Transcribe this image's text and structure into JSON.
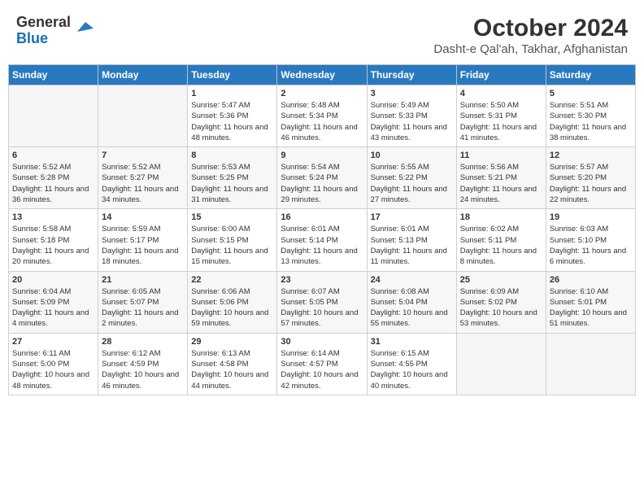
{
  "header": {
    "logo_general": "General",
    "logo_blue": "Blue",
    "month": "October 2024",
    "location": "Dasht-e Qal'ah, Takhar, Afghanistan"
  },
  "weekdays": [
    "Sunday",
    "Monday",
    "Tuesday",
    "Wednesday",
    "Thursday",
    "Friday",
    "Saturday"
  ],
  "weeks": [
    [
      {
        "day": "",
        "sunrise": "",
        "sunset": "",
        "daylight": ""
      },
      {
        "day": "",
        "sunrise": "",
        "sunset": "",
        "daylight": ""
      },
      {
        "day": "1",
        "sunrise": "Sunrise: 5:47 AM",
        "sunset": "Sunset: 5:36 PM",
        "daylight": "Daylight: 11 hours and 48 minutes."
      },
      {
        "day": "2",
        "sunrise": "Sunrise: 5:48 AM",
        "sunset": "Sunset: 5:34 PM",
        "daylight": "Daylight: 11 hours and 46 minutes."
      },
      {
        "day": "3",
        "sunrise": "Sunrise: 5:49 AM",
        "sunset": "Sunset: 5:33 PM",
        "daylight": "Daylight: 11 hours and 43 minutes."
      },
      {
        "day": "4",
        "sunrise": "Sunrise: 5:50 AM",
        "sunset": "Sunset: 5:31 PM",
        "daylight": "Daylight: 11 hours and 41 minutes."
      },
      {
        "day": "5",
        "sunrise": "Sunrise: 5:51 AM",
        "sunset": "Sunset: 5:30 PM",
        "daylight": "Daylight: 11 hours and 38 minutes."
      }
    ],
    [
      {
        "day": "6",
        "sunrise": "Sunrise: 5:52 AM",
        "sunset": "Sunset: 5:28 PM",
        "daylight": "Daylight: 11 hours and 36 minutes."
      },
      {
        "day": "7",
        "sunrise": "Sunrise: 5:52 AM",
        "sunset": "Sunset: 5:27 PM",
        "daylight": "Daylight: 11 hours and 34 minutes."
      },
      {
        "day": "8",
        "sunrise": "Sunrise: 5:53 AM",
        "sunset": "Sunset: 5:25 PM",
        "daylight": "Daylight: 11 hours and 31 minutes."
      },
      {
        "day": "9",
        "sunrise": "Sunrise: 5:54 AM",
        "sunset": "Sunset: 5:24 PM",
        "daylight": "Daylight: 11 hours and 29 minutes."
      },
      {
        "day": "10",
        "sunrise": "Sunrise: 5:55 AM",
        "sunset": "Sunset: 5:22 PM",
        "daylight": "Daylight: 11 hours and 27 minutes."
      },
      {
        "day": "11",
        "sunrise": "Sunrise: 5:56 AM",
        "sunset": "Sunset: 5:21 PM",
        "daylight": "Daylight: 11 hours and 24 minutes."
      },
      {
        "day": "12",
        "sunrise": "Sunrise: 5:57 AM",
        "sunset": "Sunset: 5:20 PM",
        "daylight": "Daylight: 11 hours and 22 minutes."
      }
    ],
    [
      {
        "day": "13",
        "sunrise": "Sunrise: 5:58 AM",
        "sunset": "Sunset: 5:18 PM",
        "daylight": "Daylight: 11 hours and 20 minutes."
      },
      {
        "day": "14",
        "sunrise": "Sunrise: 5:59 AM",
        "sunset": "Sunset: 5:17 PM",
        "daylight": "Daylight: 11 hours and 18 minutes."
      },
      {
        "day": "15",
        "sunrise": "Sunrise: 6:00 AM",
        "sunset": "Sunset: 5:15 PM",
        "daylight": "Daylight: 11 hours and 15 minutes."
      },
      {
        "day": "16",
        "sunrise": "Sunrise: 6:01 AM",
        "sunset": "Sunset: 5:14 PM",
        "daylight": "Daylight: 11 hours and 13 minutes."
      },
      {
        "day": "17",
        "sunrise": "Sunrise: 6:01 AM",
        "sunset": "Sunset: 5:13 PM",
        "daylight": "Daylight: 11 hours and 11 minutes."
      },
      {
        "day": "18",
        "sunrise": "Sunrise: 6:02 AM",
        "sunset": "Sunset: 5:11 PM",
        "daylight": "Daylight: 11 hours and 8 minutes."
      },
      {
        "day": "19",
        "sunrise": "Sunrise: 6:03 AM",
        "sunset": "Sunset: 5:10 PM",
        "daylight": "Daylight: 11 hours and 6 minutes."
      }
    ],
    [
      {
        "day": "20",
        "sunrise": "Sunrise: 6:04 AM",
        "sunset": "Sunset: 5:09 PM",
        "daylight": "Daylight: 11 hours and 4 minutes."
      },
      {
        "day": "21",
        "sunrise": "Sunrise: 6:05 AM",
        "sunset": "Sunset: 5:07 PM",
        "daylight": "Daylight: 11 hours and 2 minutes."
      },
      {
        "day": "22",
        "sunrise": "Sunrise: 6:06 AM",
        "sunset": "Sunset: 5:06 PM",
        "daylight": "Daylight: 10 hours and 59 minutes."
      },
      {
        "day": "23",
        "sunrise": "Sunrise: 6:07 AM",
        "sunset": "Sunset: 5:05 PM",
        "daylight": "Daylight: 10 hours and 57 minutes."
      },
      {
        "day": "24",
        "sunrise": "Sunrise: 6:08 AM",
        "sunset": "Sunset: 5:04 PM",
        "daylight": "Daylight: 10 hours and 55 minutes."
      },
      {
        "day": "25",
        "sunrise": "Sunrise: 6:09 AM",
        "sunset": "Sunset: 5:02 PM",
        "daylight": "Daylight: 10 hours and 53 minutes."
      },
      {
        "day": "26",
        "sunrise": "Sunrise: 6:10 AM",
        "sunset": "Sunset: 5:01 PM",
        "daylight": "Daylight: 10 hours and 51 minutes."
      }
    ],
    [
      {
        "day": "27",
        "sunrise": "Sunrise: 6:11 AM",
        "sunset": "Sunset: 5:00 PM",
        "daylight": "Daylight: 10 hours and 48 minutes."
      },
      {
        "day": "28",
        "sunrise": "Sunrise: 6:12 AM",
        "sunset": "Sunset: 4:59 PM",
        "daylight": "Daylight: 10 hours and 46 minutes."
      },
      {
        "day": "29",
        "sunrise": "Sunrise: 6:13 AM",
        "sunset": "Sunset: 4:58 PM",
        "daylight": "Daylight: 10 hours and 44 minutes."
      },
      {
        "day": "30",
        "sunrise": "Sunrise: 6:14 AM",
        "sunset": "Sunset: 4:57 PM",
        "daylight": "Daylight: 10 hours and 42 minutes."
      },
      {
        "day": "31",
        "sunrise": "Sunrise: 6:15 AM",
        "sunset": "Sunset: 4:55 PM",
        "daylight": "Daylight: 10 hours and 40 minutes."
      },
      {
        "day": "",
        "sunrise": "",
        "sunset": "",
        "daylight": ""
      },
      {
        "day": "",
        "sunrise": "",
        "sunset": "",
        "daylight": ""
      }
    ]
  ]
}
